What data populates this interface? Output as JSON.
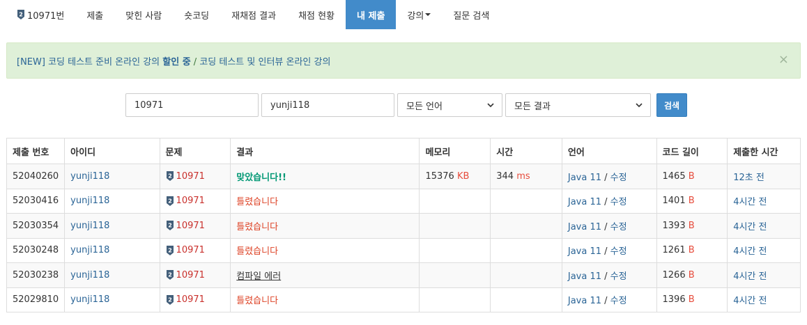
{
  "nav": {
    "problem_label": "10971번",
    "items": [
      "제출",
      "맞힌 사람",
      "숏코딩",
      "재채점 결과",
      "채점 현황"
    ],
    "active": "내 제출",
    "lecture": "강의",
    "question_search": "질문 검색"
  },
  "alert": {
    "prefix": "[NEW] 코딩 테스트 준비 온라인 강의 ",
    "highlight": "할인 중",
    "separator": " / ",
    "suffix": "코딩 테스트 및 인터뷰 온라인 강의",
    "close": "×"
  },
  "form": {
    "problem_id": "10971",
    "user_id": "yunji118",
    "language": "모든 언어",
    "result": "모든 결과",
    "search_button": "검색"
  },
  "table": {
    "headers": [
      "제출 번호",
      "아이디",
      "문제",
      "결과",
      "메모리",
      "시간",
      "언어",
      "코드 길이",
      "제출한 시간"
    ],
    "rows": [
      {
        "id": "52040260",
        "user": "yunji118",
        "problem": "10971",
        "result": "맞았습니다!!",
        "result_type": "ac",
        "memory": "15376",
        "memory_unit": "KB",
        "time": "344",
        "time_unit": "ms",
        "lang": "Java 11",
        "edit": "수정",
        "code_len": "1465",
        "code_unit": "B",
        "submitted": "12초 전"
      },
      {
        "id": "52030416",
        "user": "yunji118",
        "problem": "10971",
        "result": "틀렸습니다",
        "result_type": "wa",
        "memory": "",
        "memory_unit": "",
        "time": "",
        "time_unit": "",
        "lang": "Java 11",
        "edit": "수정",
        "code_len": "1401",
        "code_unit": "B",
        "submitted": "4시간 전"
      },
      {
        "id": "52030354",
        "user": "yunji118",
        "problem": "10971",
        "result": "틀렸습니다",
        "result_type": "wa",
        "memory": "",
        "memory_unit": "",
        "time": "",
        "time_unit": "",
        "lang": "Java 11",
        "edit": "수정",
        "code_len": "1393",
        "code_unit": "B",
        "submitted": "4시간 전"
      },
      {
        "id": "52030248",
        "user": "yunji118",
        "problem": "10971",
        "result": "틀렸습니다",
        "result_type": "wa",
        "memory": "",
        "memory_unit": "",
        "time": "",
        "time_unit": "",
        "lang": "Java 11",
        "edit": "수정",
        "code_len": "1261",
        "code_unit": "B",
        "submitted": "4시간 전"
      },
      {
        "id": "52030238",
        "user": "yunji118",
        "problem": "10971",
        "result": "컴파일 에러",
        "result_type": "ce",
        "memory": "",
        "memory_unit": "",
        "time": "",
        "time_unit": "",
        "lang": "Java 11",
        "edit": "수정",
        "code_len": "1266",
        "code_unit": "B",
        "submitted": "4시간 전"
      },
      {
        "id": "52029810",
        "user": "yunji118",
        "problem": "10971",
        "result": "틀렸습니다",
        "result_type": "wa",
        "memory": "",
        "memory_unit": "",
        "time": "",
        "time_unit": "",
        "lang": "Java 11",
        "edit": "수정",
        "code_len": "1396",
        "code_unit": "B",
        "submitted": "4시간 전"
      }
    ]
  },
  "colors": {
    "primary": "#428bca",
    "alert_bg": "#dff0d8",
    "accepted": "#009874",
    "wrong": "#dd4124",
    "link": "#2a6496",
    "tier_badge": "#435f7a"
  }
}
